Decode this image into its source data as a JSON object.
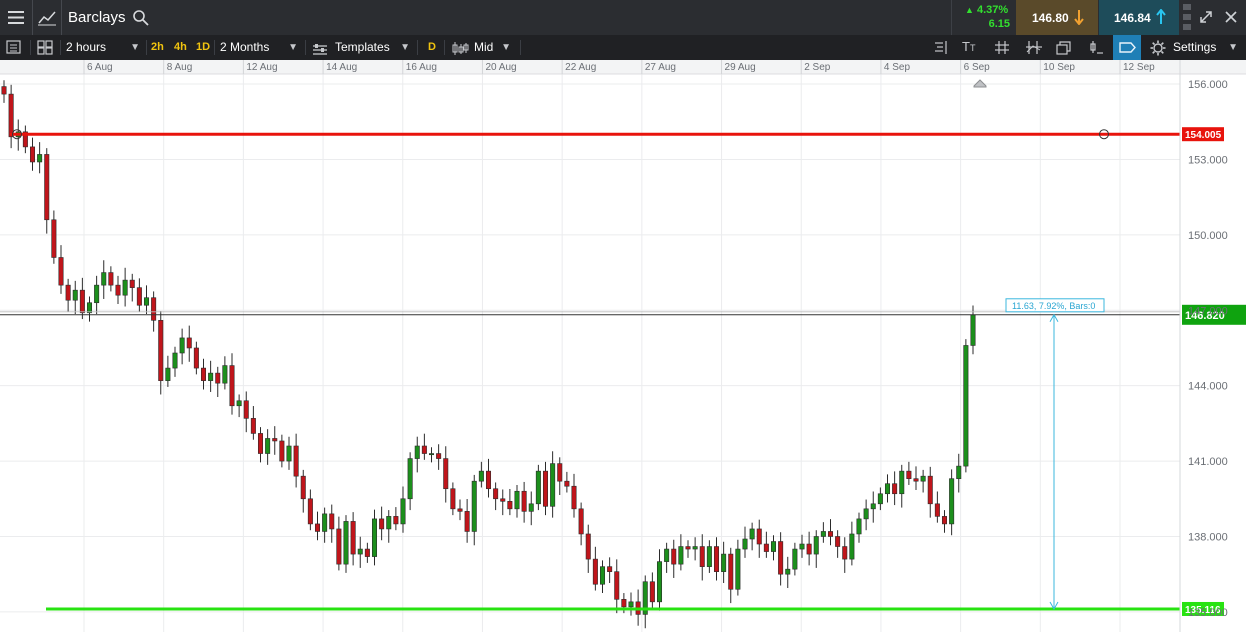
{
  "header": {
    "instrument": "Barclays",
    "change_percent": "4.37%",
    "change_value": "6.15",
    "sell_price": "146.80",
    "buy_price": "146.84"
  },
  "toolbar": {
    "interval": "2 hours",
    "quick_intervals": [
      "2h",
      "4h",
      "1D"
    ],
    "range": "2 Months",
    "templates_label": "Templates",
    "d_label": "D",
    "price_type": "Mid",
    "settings_label": "Settings"
  },
  "chart_data": {
    "type": "candlestick",
    "x_ticks": [
      "6 Aug",
      "8 Aug",
      "12 Aug",
      "14 Aug",
      "16 Aug",
      "20 Aug",
      "22 Aug",
      "27 Aug",
      "29 Aug",
      "2 Sep",
      "4 Sep",
      "6 Sep",
      "10 Sep",
      "12 Sep"
    ],
    "y_ticks": [
      156.0,
      153.0,
      150.0,
      147.0,
      144.0,
      141.0,
      138.0,
      135.0
    ],
    "y_tick_labels": [
      "156.000",
      "153.000",
      "150.000",
      "147.000",
      "144.000",
      "141.000",
      "138.000",
      "135.000"
    ],
    "ylim": [
      134.2,
      156.4
    ],
    "grid": true,
    "horizontal_lines": [
      {
        "value": 154.005,
        "label": "154.005",
        "color": "#e8130c"
      },
      {
        "value": 135.116,
        "label": "135.116",
        "color": "#28e312"
      }
    ],
    "current_price": {
      "value": 146.82,
      "label": "146.820",
      "color": "#0fa30f"
    },
    "measure": {
      "label": "11.63, 7.92%, Bars:0",
      "from": 135.116,
      "to": 146.82
    },
    "closes": [
      155.6,
      153.9,
      154.1,
      153.5,
      152.9,
      153.2,
      150.6,
      149.1,
      148.0,
      147.4,
      147.8,
      146.9,
      147.3,
      148.0,
      148.5,
      148.0,
      147.6,
      148.2,
      147.9,
      147.2,
      147.5,
      146.6,
      144.2,
      144.7,
      145.3,
      145.9,
      145.5,
      144.7,
      144.2,
      144.5,
      144.1,
      144.8,
      143.2,
      143.4,
      142.7,
      142.1,
      141.3,
      141.9,
      141.8,
      141.0,
      141.6,
      140.4,
      139.5,
      138.5,
      138.2,
      138.9,
      138.3,
      136.9,
      138.6,
      137.3,
      137.5,
      137.2,
      138.7,
      138.3,
      138.8,
      138.5,
      139.5,
      141.1,
      141.6,
      141.3,
      141.3,
      141.1,
      139.9,
      139.1,
      139.0,
      138.2,
      140.2,
      140.6,
      139.9,
      139.5,
      139.4,
      139.1,
      139.8,
      139.0,
      139.3,
      140.6,
      139.2,
      140.9,
      140.2,
      140.0,
      139.1,
      138.1,
      137.1,
      136.1,
      136.8,
      136.6,
      135.5,
      135.2,
      135.4,
      134.9,
      136.2,
      135.4,
      137.0,
      137.5,
      136.9,
      137.6,
      137.5,
      137.6,
      136.8,
      137.6,
      136.6,
      137.3,
      135.9,
      137.5,
      137.9,
      138.3,
      137.7,
      137.4,
      137.8,
      136.5,
      136.7,
      137.5,
      137.7,
      137.3,
      138.0,
      138.2,
      138.0,
      137.6,
      137.1,
      138.1,
      138.7,
      139.1,
      139.3,
      139.7,
      140.1,
      139.7,
      140.6,
      140.3,
      140.2,
      140.4,
      139.3,
      138.8,
      138.5,
      140.3,
      140.8,
      145.6,
      146.82
    ]
  }
}
